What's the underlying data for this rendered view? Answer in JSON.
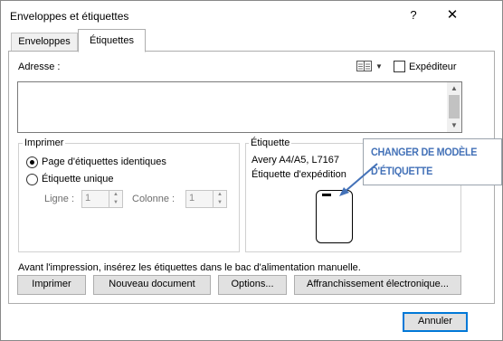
{
  "window": {
    "title": "Enveloppes et étiquettes",
    "help_glyph": "?",
    "close_glyph": "✕"
  },
  "tabs": [
    {
      "label": "Enveloppes",
      "active": false
    },
    {
      "label": "Étiquettes",
      "active": true
    }
  ],
  "address": {
    "label": "Adresse :",
    "value": "",
    "address_book_icon": "address-book-icon",
    "sender_checkbox_label": "Expéditeur",
    "sender_checked": false
  },
  "print": {
    "group_label": "Imprimer",
    "options": [
      {
        "label": "Page d'étiquettes identiques",
        "selected": true
      },
      {
        "label": "Étiquette unique",
        "selected": false
      }
    ],
    "row_label": "Ligne :",
    "row_value": "1",
    "column_label": "Colonne :",
    "column_value": "1"
  },
  "label": {
    "group_label": "Étiquette",
    "product": "Avery A4/A5, L7167",
    "type": "Étiquette d'expédition"
  },
  "callout": {
    "line1": "CHANGER DE MODÈLE",
    "line2": "D'ÉTIQUETTE",
    "color": "#4472b8"
  },
  "instruction": "Avant l'impression, insérez les étiquettes dans le bac d'alimentation manuelle.",
  "buttons": {
    "print": "Imprimer",
    "new_document": "Nouveau document",
    "options": "Options...",
    "postage": "Affranchissement électronique...",
    "cancel": "Annuler"
  }
}
